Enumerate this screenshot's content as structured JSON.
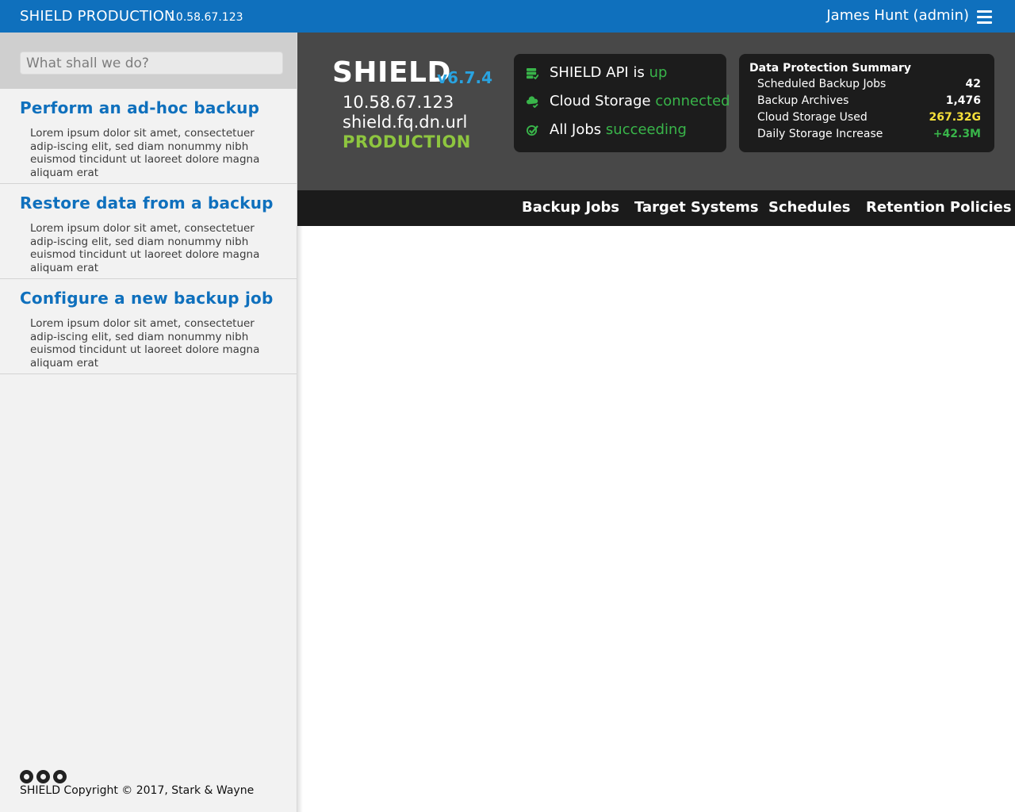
{
  "topbar": {
    "brand": "SHIELD PRODUCTION",
    "ip": "10.58.67.123",
    "user": "James Hunt (admin)"
  },
  "sidebar": {
    "search_placeholder": "What shall we do?",
    "actions": [
      {
        "title": "Perform an ad-hoc backup",
        "description": "Lorem ipsum dolor sit amet, consectetuer adip-iscing elit, sed diam nonummy nibh euismod tincidunt ut laoreet dolore magna aliquam erat"
      },
      {
        "title": "Restore data from a backup",
        "description": "Lorem ipsum dolor sit amet, consectetuer adip-iscing elit, sed diam nonummy nibh euismod tincidunt ut laoreet dolore magna aliquam erat"
      },
      {
        "title": "Configure a new backup job",
        "description": "Lorem ipsum dolor sit amet, consectetuer adip-iscing elit, sed diam nonummy nibh euismod tincidunt ut laoreet dolore magna aliquam erat"
      }
    ],
    "social_icons": [
      "github-icon",
      "slack-icon",
      "twitter-icon"
    ],
    "copyright": "SHIELD Copyright © 2017, Stark & Wayne"
  },
  "header": {
    "title": "SHIELD",
    "version": "v6.7.4",
    "ip": "10.58.67.123",
    "host": "shield.fq.dn.url",
    "env": "PRODUCTION",
    "env_color": "#8ec63f",
    "version_color": "#29a3e0"
  },
  "status": {
    "api_label": "SHIELD API is",
    "api_value": "up",
    "storage_label": "Cloud Storage",
    "storage_value": "connected",
    "jobs_label": "All Jobs",
    "jobs_value": "succeeding",
    "good_color": "#39b54a"
  },
  "summary": {
    "title": "Data Protection Summary",
    "rows": [
      {
        "label": "Scheduled Backup Jobs",
        "value": "42",
        "color": "#ffffff"
      },
      {
        "label": "Backup Archives",
        "value": "1,476",
        "color": "#ffffff"
      },
      {
        "label": "Cloud Storage Used",
        "value": "267.32G",
        "color": "#f6e03a"
      },
      {
        "label": "Daily Storage Increase",
        "value": "+42.3M",
        "color": "#39b54a"
      }
    ]
  },
  "nav": {
    "tabs": [
      "Backup Jobs",
      "Target Systems",
      "Schedules",
      "Retention Policies"
    ]
  },
  "colors": {
    "topbar": "#0f70bd",
    "header_bg": "#484848",
    "nav_bg": "#1b1b1b",
    "link_blue": "#0f70bd"
  }
}
